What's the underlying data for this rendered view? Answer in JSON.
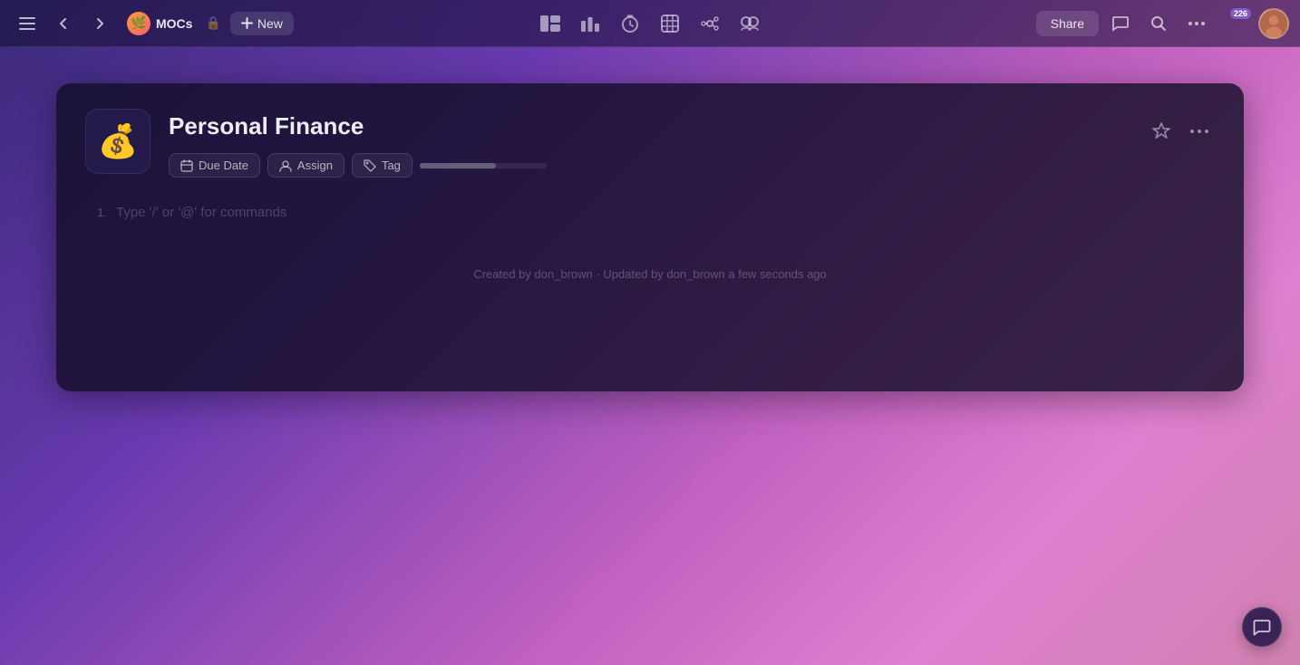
{
  "navbar": {
    "workspace_name": "MOCs",
    "workspace_emoji": "🌿",
    "new_label": "New",
    "share_label": "Share",
    "notification_count": "226",
    "lock_icon": "🔒",
    "plus_icon": "+"
  },
  "toolbar": {
    "tools": [
      {
        "name": "layout-icon",
        "symbol": "⊟"
      },
      {
        "name": "bar-chart-icon",
        "symbol": "▐▌"
      },
      {
        "name": "clock-icon",
        "symbol": "⏱"
      },
      {
        "name": "table-icon",
        "symbol": "⊞"
      },
      {
        "name": "share-network-icon",
        "symbol": "⊕"
      },
      {
        "name": "group-icon",
        "symbol": "⊛"
      }
    ]
  },
  "document": {
    "icon": "💰",
    "title": "Personal Finance",
    "due_date_label": "Due Date",
    "assign_label": "Assign",
    "tag_label": "Tag",
    "progress_percent": 60,
    "placeholder_text": "Type '/' or '@' for commands",
    "line_number": "1.",
    "footer_text": "Created by don_brown · Updated by don_brown a few seconds ago",
    "star_label": "★",
    "more_label": "···"
  },
  "chat": {
    "icon": "💬"
  }
}
